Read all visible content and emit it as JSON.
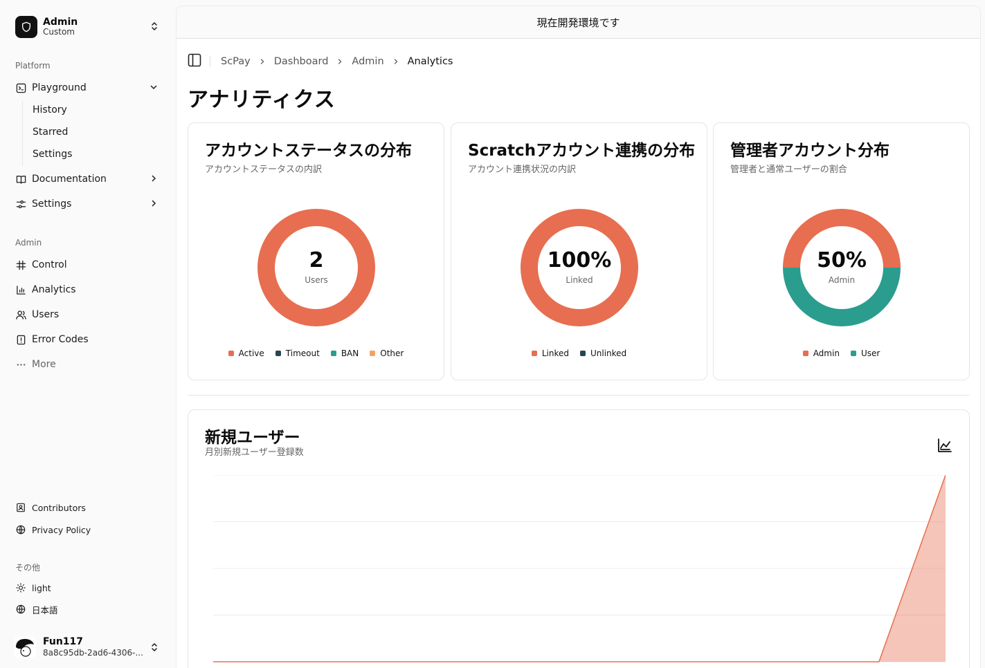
{
  "team": {
    "name": "Admin",
    "plan": "Custom"
  },
  "sidebar": {
    "platform_label": "Platform",
    "platform_items": [
      {
        "label": "Playground",
        "icon": "terminal-icon"
      },
      {
        "label": "Documentation",
        "icon": "book-icon"
      },
      {
        "label": "Settings",
        "icon": "sliders-icon"
      }
    ],
    "playground_sub": [
      "History",
      "Starred",
      "Settings"
    ],
    "admin_label": "Admin",
    "admin_items": [
      {
        "label": "Control",
        "icon": "hash-icon"
      },
      {
        "label": "Analytics",
        "icon": "bar-chart-icon"
      },
      {
        "label": "Users",
        "icon": "users-icon"
      },
      {
        "label": "Error Codes",
        "icon": "file-alert-icon"
      },
      {
        "label": "More",
        "icon": "more-icon"
      }
    ],
    "footer_items": [
      {
        "label": "Contributors",
        "icon": "contact-icon"
      },
      {
        "label": "Privacy Policy",
        "icon": "globe-lock-icon"
      }
    ],
    "other_label": "その他",
    "other_items": [
      {
        "label": "light",
        "icon": "sun-icon"
      },
      {
        "label": "日本語",
        "icon": "globe-icon"
      }
    ]
  },
  "user": {
    "name": "Fun117",
    "id": "8a8c95db-2ad6-4306-..."
  },
  "banner": "現在開発環境です",
  "breadcrumb": [
    "ScPay",
    "Dashboard",
    "Admin",
    "Analytics"
  ],
  "page_title": "アナリティクス",
  "colors": {
    "orange": "#e76e50",
    "teal": "#2a9d8f",
    "navy": "#264653",
    "amber": "#f4a261"
  },
  "cards": [
    {
      "title": "アカウントステータスの分布",
      "subtitle": "アカウントステータスの内訳",
      "center_value": "2",
      "center_label": "Users",
      "legend": [
        {
          "label": "Active",
          "color": "#e76e50"
        },
        {
          "label": "Timeout",
          "color": "#264653"
        },
        {
          "label": "BAN",
          "color": "#2a9d8f"
        },
        {
          "label": "Other",
          "color": "#f4a261"
        }
      ]
    },
    {
      "title": "Scratchアカウント連携の分布",
      "subtitle": "アカウント連携状況の内訳",
      "center_value": "100%",
      "center_label": "Linked",
      "legend": [
        {
          "label": "Linked",
          "color": "#e76e50"
        },
        {
          "label": "Unlinked",
          "color": "#264653"
        }
      ]
    },
    {
      "title": "管理者アカウント分布",
      "subtitle": "管理者と通常ユーザーの割合",
      "center_value": "50%",
      "center_label": "Admin",
      "legend": [
        {
          "label": "Admin",
          "color": "#e76e50"
        },
        {
          "label": "User",
          "color": "#2a9d8f"
        }
      ]
    }
  ],
  "chart_data": [
    {
      "type": "pie",
      "categories": [
        "Active",
        "Timeout",
        "BAN",
        "Other"
      ],
      "values": [
        2,
        0,
        0,
        0
      ]
    },
    {
      "type": "pie",
      "categories": [
        "Linked",
        "Unlinked"
      ],
      "values": [
        100,
        0
      ]
    },
    {
      "type": "pie",
      "categories": [
        "Admin",
        "User"
      ],
      "values": [
        50,
        50
      ]
    },
    {
      "type": "area",
      "title": "新規ユーザー",
      "subtitle": "月別新規ユーザー登録数",
      "x": [
        1,
        2,
        3,
        4,
        5,
        6,
        7,
        8,
        9,
        10,
        11,
        12
      ],
      "values": [
        0,
        0,
        0,
        0,
        0,
        0,
        0,
        0,
        0,
        0,
        0,
        2
      ],
      "ylim": [
        0,
        2
      ],
      "grid": true,
      "color": "#e76e50"
    }
  ]
}
